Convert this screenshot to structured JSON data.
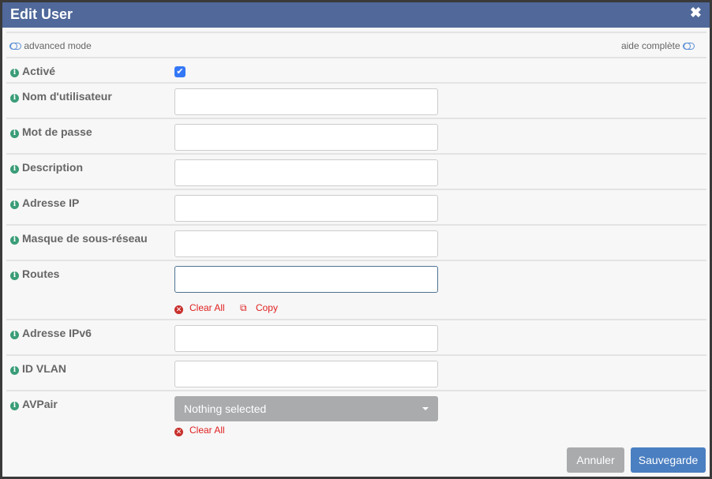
{
  "title": "Edit User",
  "advanced_mode": "advanced mode",
  "full_help": "aide complète",
  "fields": [
    {
      "label": "Activé",
      "type": "checkbox",
      "checked": true
    },
    {
      "label": "Nom d'utilisateur",
      "type": "text",
      "value": ""
    },
    {
      "label": "Mot de passe",
      "type": "text",
      "value": ""
    },
    {
      "label": "Description",
      "type": "text",
      "value": ""
    },
    {
      "label": "Adresse IP",
      "type": "text",
      "value": ""
    },
    {
      "label": "Masque de sous-réseau",
      "type": "text",
      "value": ""
    },
    {
      "label": "Routes",
      "type": "text",
      "value": "",
      "clear": "Clear All",
      "copy": "Copy"
    },
    {
      "label": "Adresse IPv6",
      "type": "text",
      "value": ""
    },
    {
      "label": "ID VLAN",
      "type": "text",
      "value": ""
    },
    {
      "label": "AVPair",
      "type": "select",
      "value": "Nothing selected",
      "clear": "Clear All"
    }
  ],
  "buttons": {
    "cancel": "Annuler",
    "save": "Sauvegarde"
  },
  "colors": {
    "header": "#50699a",
    "save": "#4a7fc1",
    "info": "#3a9d78",
    "link": "#e02020"
  }
}
